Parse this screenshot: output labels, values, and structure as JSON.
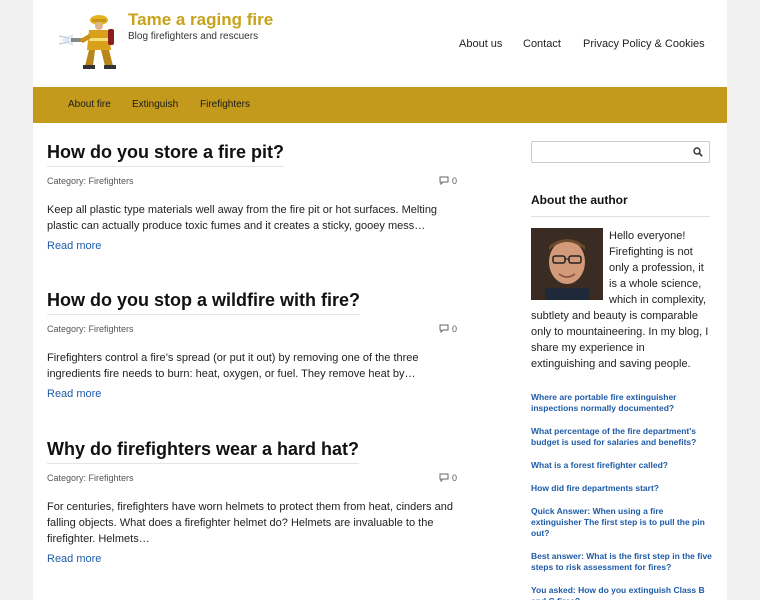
{
  "header": {
    "title": "Tame a raging fire",
    "tagline": "Blog firefighters and rescuers",
    "links": [
      "About us",
      "Contact",
      "Privacy Policy & Cookies"
    ]
  },
  "navbar": {
    "items": [
      "About fire",
      "Extinguish",
      "Firefighters"
    ]
  },
  "articles": [
    {
      "title": "How do you store a fire pit?",
      "category": "Category: Firefighters",
      "comments": "0",
      "excerpt": "Keep all plastic type materials well away from the fire pit or hot surfaces. Melting plastic can actually produce toxic fumes and it creates a sticky, gooey mess…",
      "readmore": "Read more"
    },
    {
      "title": "How do you stop a wildfire with fire?",
      "category": "Category: Firefighters",
      "comments": "0",
      "excerpt": "Firefighters control a fire’s spread (or put it out) by removing one of the three ingredients fire needs to burn: heat, oxygen, or fuel. They remove heat by…",
      "readmore": "Read more"
    },
    {
      "title": "Why do firefighters wear a hard hat?",
      "category": "Category: Firefighters",
      "comments": "0",
      "excerpt": "For centuries, firefighters have worn helmets to protect them from heat, cinders and falling objects. What does a firefighter helmet do? Helmets are invaluable to the firefighter. Helmets…",
      "readmore": "Read more"
    }
  ],
  "sidebar": {
    "about_title": "About the author",
    "about_text": "Hello everyone! Firefighting is not only a profession, it is a whole science, which in complexity, subtlety and beauty is comparable only to mountaineering. In my blog, I share my experience in extinguishing and saving people.",
    "links": [
      "Where are portable fire extinguisher inspections normally documented?",
      "What percentage of the fire department's budget is used for salaries and benefits?",
      "What is a forest firefighter called?",
      "How did fire departments start?",
      "Quick Answer: When using a fire extinguisher The first step is to pull the pin out?",
      "Best answer: What is the first step in the five steps to risk assessment for fires?",
      "You asked: How do you extinguish Class B and C fires?"
    ]
  },
  "colors": {
    "accent": "#c49a1c",
    "title": "#c8a21a",
    "link": "#1e5ba8"
  },
  "icons": [
    "firefighter-logo",
    "search-icon",
    "comment-icon"
  ]
}
